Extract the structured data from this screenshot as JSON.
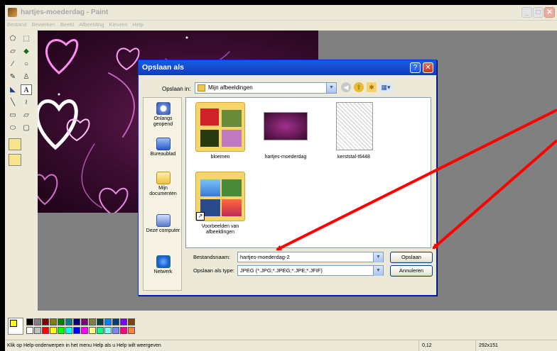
{
  "app": {
    "title": "hartjes-moederdag - Paint",
    "menu": [
      "Bestand",
      "Bewerken",
      "Beeld",
      "Afbeelding",
      "Kleuren",
      "Help"
    ]
  },
  "toolbox": {
    "tools": [
      "free-select",
      "rect-select",
      "eraser",
      "fill",
      "color-picker",
      "magnifier",
      "pencil",
      "brush",
      "airbrush",
      "text",
      "line",
      "curve",
      "rectangle",
      "polygon",
      "ellipse",
      "rounded-rect"
    ]
  },
  "palette": {
    "foreground": "#000000",
    "background": "#ffff00",
    "colors_top": [
      "#000000",
      "#808080",
      "#800000",
      "#808000",
      "#008000",
      "#008080",
      "#000080",
      "#800080",
      "#808040",
      "#004040",
      "#0080ff",
      "#004080",
      "#8000ff",
      "#804000"
    ],
    "colors_bottom": [
      "#ffffff",
      "#c0c0c0",
      "#ff0000",
      "#ffff00",
      "#00ff00",
      "#00ffff",
      "#0000ff",
      "#ff00ff",
      "#ffff80",
      "#00ff80",
      "#80ffff",
      "#8080ff",
      "#ff0080",
      "#ff8040"
    ]
  },
  "status": {
    "help_text": "Klik op Help-onderwerpen in het menu Help als u Help wilt weergeven",
    "coords": "0,12",
    "size": "292x151"
  },
  "dialog": {
    "title": "Opslaan als",
    "help_btn": "?",
    "close_btn": "✕",
    "save_in_label": "Opslaan in:",
    "save_in_value": "Mijn afbeeldingen",
    "places": [
      "Onlangs geopend",
      "Bureaublad",
      "Mijn documenten",
      "Deze computer",
      "Netwerk"
    ],
    "files": [
      {
        "name": "bloemen",
        "kind": "folder"
      },
      {
        "name": "hartjes-moederdag",
        "kind": "image"
      },
      {
        "name": "kerststal-t6448",
        "kind": "image"
      },
      {
        "name": "Voorbeelden van afbeeldingen",
        "kind": "folder-shortcut"
      }
    ],
    "filename_label": "Bestandsnaam:",
    "filename_value": "hartjes-moederdag-2",
    "filetype_label": "Opslaan als type:",
    "filetype_value": "JPEG (*.JPG;*.JPEG;*.JPE;*.JFIF)",
    "save_button": "Opslaan",
    "cancel_button": "Annuleren"
  },
  "colors": {
    "dialog_title_bar": "#0a5fe6",
    "annotation_arrows": "#ff0000",
    "canvas_gray": "#808080"
  }
}
